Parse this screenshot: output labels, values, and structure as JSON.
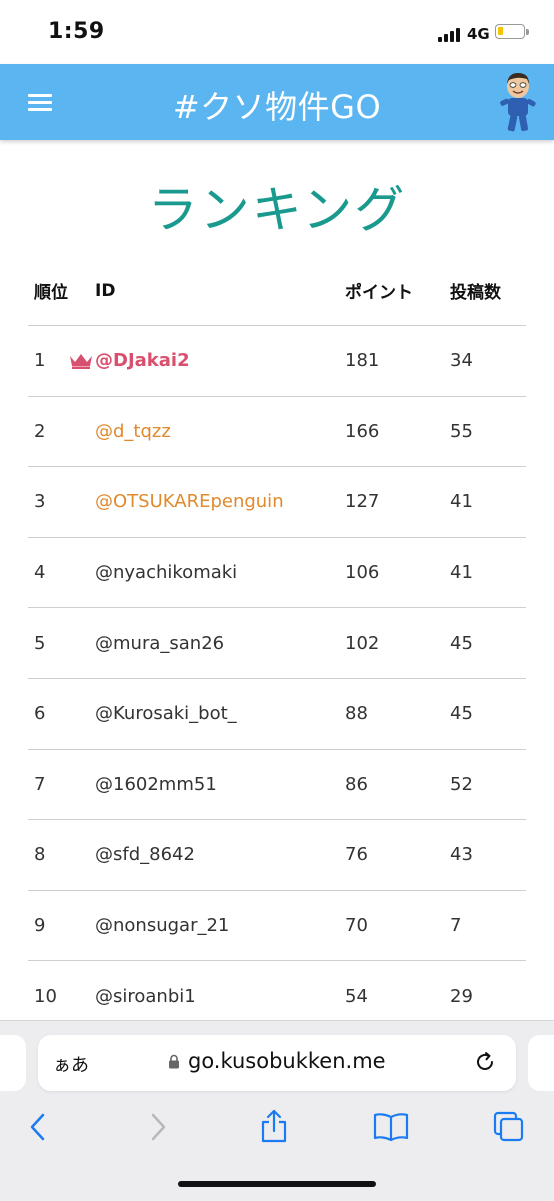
{
  "status_bar": {
    "time": "1:59",
    "network": "4G",
    "battery_level": 0.2
  },
  "header": {
    "menu_icon": "hamburger-menu-icon",
    "title": "#クソ物件GO",
    "avatar_icon": "user-avatar-icon"
  },
  "page": {
    "title": "ランキング"
  },
  "table": {
    "headers": {
      "rank": "順位",
      "id": "ID",
      "points": "ポイント",
      "posts": "投稿数"
    },
    "rows": [
      {
        "rank": "1",
        "id": "@DJakai2",
        "points": "181",
        "posts": "34",
        "badge": "crown-icon"
      },
      {
        "rank": "2",
        "id": "@d_tqzz",
        "points": "166",
        "posts": "55"
      },
      {
        "rank": "3",
        "id": "@OTSUKAREpenguin",
        "points": "127",
        "posts": "41"
      },
      {
        "rank": "4",
        "id": "@nyachikomaki",
        "points": "106",
        "posts": "41"
      },
      {
        "rank": "5",
        "id": "@mura_san26",
        "points": "102",
        "posts": "45"
      },
      {
        "rank": "6",
        "id": "@Kurosaki_bot_",
        "points": "88",
        "posts": "45"
      },
      {
        "rank": "7",
        "id": "@1602mm51",
        "points": "86",
        "posts": "52"
      },
      {
        "rank": "8",
        "id": "@sfd_8642",
        "points": "76",
        "posts": "43"
      },
      {
        "rank": "9",
        "id": "@nonsugar_21",
        "points": "70",
        "posts": "7"
      },
      {
        "rank": "10",
        "id": "@siroanbi1",
        "points": "54",
        "posts": "29"
      }
    ]
  },
  "browser": {
    "aa_label": "ぁあ",
    "url": "go.kusobukken.me"
  },
  "colors": {
    "header_bg": "#5bb5f0",
    "title_teal": "#1a9a8e",
    "first_place": "#d9506e",
    "top_three": "#e08a2e",
    "ios_blue": "#1a7bf2"
  }
}
